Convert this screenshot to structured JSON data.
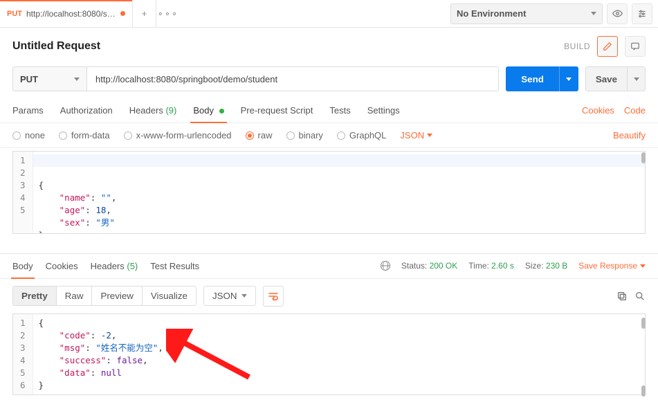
{
  "tab": {
    "method": "PUT",
    "title": "http://localhost:8080/springbo...",
    "modified": true
  },
  "tabControls": {
    "add": "+",
    "more": "∘∘∘"
  },
  "env": {
    "selected": "No Environment"
  },
  "request": {
    "name": "Untitled Request",
    "build": "BUILD",
    "method": "PUT",
    "url": "http://localhost:8080/springboot/demo/student",
    "send": "Send",
    "save": "Save"
  },
  "reqTabs": {
    "params": "Params",
    "authorization": "Authorization",
    "headers": "Headers",
    "headersCount": "(9)",
    "body": "Body",
    "prerequest": "Pre-request Script",
    "tests": "Tests",
    "settings": "Settings",
    "cookies": "Cookies",
    "code": "Code"
  },
  "bodyTypes": {
    "none": "none",
    "formdata": "form-data",
    "xwww": "x-www-form-urlencoded",
    "raw": "raw",
    "binary": "binary",
    "graphql": "GraphQL",
    "format": "JSON",
    "beautify": "Beautify"
  },
  "reqBody": {
    "lines": [
      "1",
      "2",
      "3",
      "4",
      "5"
    ],
    "json": {
      "name": "",
      "age": 18,
      "sex": "男"
    }
  },
  "respTabs": {
    "body": "Body",
    "cookies": "Cookies",
    "headers": "Headers",
    "headersCount": "(5)",
    "tests": "Test Results"
  },
  "respMeta": {
    "statusLabel": "Status:",
    "status": "200 OK",
    "timeLabel": "Time:",
    "time": "2.60 s",
    "sizeLabel": "Size:",
    "size": "230 B",
    "saveResponse": "Save Response"
  },
  "respToolbar": {
    "pretty": "Pretty",
    "raw": "Raw",
    "preview": "Preview",
    "visualize": "Visualize",
    "format": "JSON"
  },
  "respBody": {
    "lines": [
      "1",
      "2",
      "3",
      "4",
      "5",
      "6"
    ],
    "json": {
      "code": -2,
      "msg": "姓名不能为空",
      "success": false,
      "data": null
    }
  }
}
